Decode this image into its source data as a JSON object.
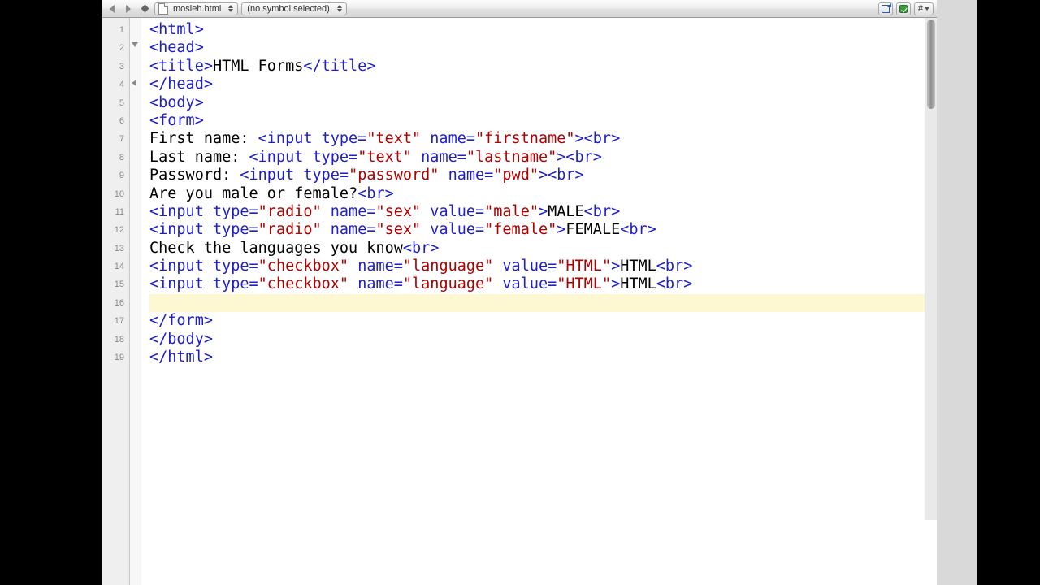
{
  "toolbar": {
    "filename": "mosleh.html",
    "symbol_text": "(no symbol selected)",
    "hash": "#"
  },
  "gutter": {
    "lines": [
      "1",
      "2",
      "3",
      "4",
      "5",
      "6",
      "7",
      "8",
      "9",
      "10",
      "11",
      "12",
      "13",
      "14",
      "15",
      "16",
      "17",
      "18",
      "19"
    ]
  },
  "code": {
    "current_line_index": 15,
    "lines": [
      [
        {
          "c": "tag",
          "t": "<html>"
        }
      ],
      [
        {
          "c": "tag",
          "t": "<head>"
        }
      ],
      [
        {
          "c": "tag",
          "t": "<title>"
        },
        {
          "c": "",
          "t": "HTML Forms"
        },
        {
          "c": "tag",
          "t": "</title>"
        }
      ],
      [
        {
          "c": "tag",
          "t": "</head>"
        }
      ],
      [
        {
          "c": "tag",
          "t": "<body>"
        }
      ],
      [
        {
          "c": "tag",
          "t": "<form>"
        }
      ],
      [
        {
          "c": "",
          "t": "First name: "
        },
        {
          "c": "tag",
          "t": "<input "
        },
        {
          "c": "attr",
          "t": "type="
        },
        {
          "c": "str",
          "t": "\"text\""
        },
        {
          "c": "attr",
          "t": " name="
        },
        {
          "c": "str",
          "t": "\"firstname\""
        },
        {
          "c": "tag",
          "t": "><br>"
        }
      ],
      [
        {
          "c": "",
          "t": "Last name: "
        },
        {
          "c": "tag",
          "t": "<input "
        },
        {
          "c": "attr",
          "t": "type="
        },
        {
          "c": "str",
          "t": "\"text\""
        },
        {
          "c": "attr",
          "t": " name="
        },
        {
          "c": "str",
          "t": "\"lastname\""
        },
        {
          "c": "tag",
          "t": "><br>"
        }
      ],
      [
        {
          "c": "",
          "t": "Password: "
        },
        {
          "c": "tag",
          "t": "<input "
        },
        {
          "c": "attr",
          "t": "type="
        },
        {
          "c": "str",
          "t": "\"password\""
        },
        {
          "c": "attr",
          "t": " name="
        },
        {
          "c": "str",
          "t": "\"pwd\""
        },
        {
          "c": "tag",
          "t": "><br>"
        }
      ],
      [
        {
          "c": "",
          "t": "Are you male or female?"
        },
        {
          "c": "tag",
          "t": "<br>"
        }
      ],
      [
        {
          "c": "tag",
          "t": "<input "
        },
        {
          "c": "attr",
          "t": "type="
        },
        {
          "c": "str",
          "t": "\"radio\""
        },
        {
          "c": "attr",
          "t": " name="
        },
        {
          "c": "str",
          "t": "\"sex\""
        },
        {
          "c": "attr",
          "t": " value="
        },
        {
          "c": "str",
          "t": "\"male\""
        },
        {
          "c": "tag",
          "t": ">"
        },
        {
          "c": "",
          "t": "MALE"
        },
        {
          "c": "tag",
          "t": "<br>"
        }
      ],
      [
        {
          "c": "tag",
          "t": "<input "
        },
        {
          "c": "attr",
          "t": "type="
        },
        {
          "c": "str",
          "t": "\"radio\""
        },
        {
          "c": "attr",
          "t": " name="
        },
        {
          "c": "str",
          "t": "\"sex\""
        },
        {
          "c": "attr",
          "t": " value="
        },
        {
          "c": "str",
          "t": "\"female\""
        },
        {
          "c": "tag",
          "t": ">"
        },
        {
          "c": "",
          "t": "FEMALE"
        },
        {
          "c": "tag",
          "t": "<br>"
        }
      ],
      [
        {
          "c": "",
          "t": "Check the languages you know"
        },
        {
          "c": "tag",
          "t": "<br>"
        }
      ],
      [
        {
          "c": "tag",
          "t": "<input "
        },
        {
          "c": "attr",
          "t": "type="
        },
        {
          "c": "str",
          "t": "\"checkbox\""
        },
        {
          "c": "attr",
          "t": " name="
        },
        {
          "c": "str",
          "t": "\"language\""
        },
        {
          "c": "attr",
          "t": " value="
        },
        {
          "c": "str",
          "t": "\"HTML\""
        },
        {
          "c": "tag",
          "t": ">"
        },
        {
          "c": "",
          "t": "HTML"
        },
        {
          "c": "tag",
          "t": "<br>"
        }
      ],
      [
        {
          "c": "tag",
          "t": "<input "
        },
        {
          "c": "attr",
          "t": "type="
        },
        {
          "c": "str",
          "t": "\"checkbox\""
        },
        {
          "c": "attr",
          "t": " name="
        },
        {
          "c": "str",
          "t": "\"language\""
        },
        {
          "c": "attr",
          "t": " value="
        },
        {
          "c": "str",
          "t": "\"HTML\""
        },
        {
          "c": "tag",
          "t": ">"
        },
        {
          "c": "",
          "t": "HTML"
        },
        {
          "c": "tag",
          "t": "<br>"
        }
      ],
      [],
      [
        {
          "c": "tag",
          "t": "</form>"
        }
      ],
      [
        {
          "c": "tag",
          "t": "</body>"
        }
      ],
      [
        {
          "c": "tag",
          "t": "</html>"
        }
      ]
    ]
  }
}
